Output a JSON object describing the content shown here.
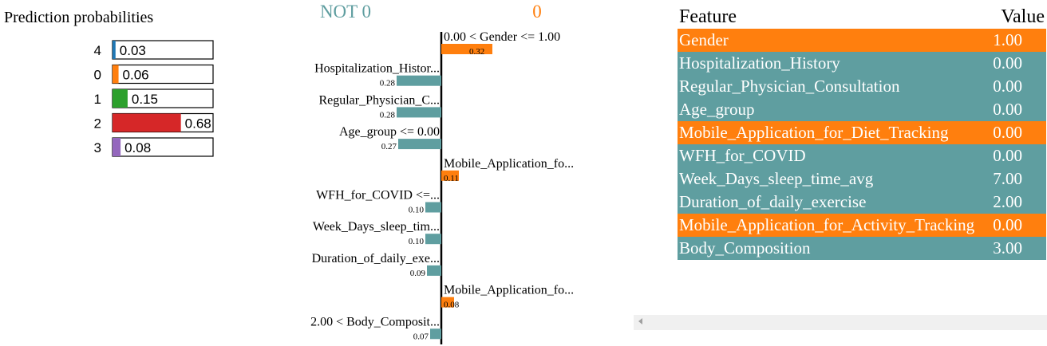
{
  "colors": {
    "positive": "#ff7f0e",
    "negative": "#5f9ea0",
    "class_4": "#1f77b4",
    "class_0": "#ff7f0e",
    "class_1": "#2ca02c",
    "class_2": "#d62728",
    "class_3": "#9467bd"
  },
  "chart_data": [
    {
      "type": "bar",
      "title": "Prediction probabilities",
      "categories": [
        "4",
        "0",
        "1",
        "2",
        "3"
      ],
      "values": [
        0.03,
        0.06,
        0.15,
        0.68,
        0.08
      ],
      "value_labels": [
        "0.03",
        "0.06",
        "0.15",
        "0.68",
        "0.08"
      ],
      "xlim": [
        0,
        1
      ]
    },
    {
      "type": "bar",
      "header_negative": "NOT 0",
      "header_positive": "0",
      "categories": [
        "0.00 < Gender <= 1.00",
        "Hospitalization_Histor...",
        "Regular_Physician_C...",
        "Age_group <= 0.00",
        "Mobile_Application_fo...",
        "WFH_for_COVID <=...",
        "Week_Days_sleep_tim...",
        "Duration_of_daily_exe...",
        "Mobile_Application_fo...",
        "2.00 < Body_Composit..."
      ],
      "values": [
        0.32,
        -0.28,
        -0.28,
        -0.27,
        0.11,
        -0.1,
        -0.1,
        -0.09,
        0.08,
        -0.07
      ],
      "value_labels": [
        "0.32",
        "0.28",
        "0.28",
        "0.27",
        "0.11",
        "0.10",
        "0.10",
        "0.09",
        "0.08",
        "0.07"
      ]
    }
  ],
  "table": {
    "headers": {
      "feature": "Feature",
      "value": "Value"
    },
    "rows": [
      {
        "feature": "Gender",
        "value": "1.00",
        "highlight": true
      },
      {
        "feature": "Hospitalization_History",
        "value": "0.00",
        "highlight": false
      },
      {
        "feature": "Regular_Physician_Consultation",
        "value": "0.00",
        "highlight": false
      },
      {
        "feature": "Age_group",
        "value": "0.00",
        "highlight": false
      },
      {
        "feature": "Mobile_Application_for_Diet_Tracking",
        "value": "0.00",
        "highlight": true
      },
      {
        "feature": "WFH_for_COVID",
        "value": "0.00",
        "highlight": false
      },
      {
        "feature": "Week_Days_sleep_time_avg",
        "value": "7.00",
        "highlight": false
      },
      {
        "feature": "Duration_of_daily_exercise",
        "value": "2.00",
        "highlight": false
      },
      {
        "feature": "Mobile_Application_for_Activity_Tracking",
        "value": "0.00",
        "highlight": true
      },
      {
        "feature": "Body_Composition",
        "value": "3.00",
        "highlight": false
      }
    ]
  },
  "scrollbar": {
    "icon": "chevron-left-icon"
  }
}
